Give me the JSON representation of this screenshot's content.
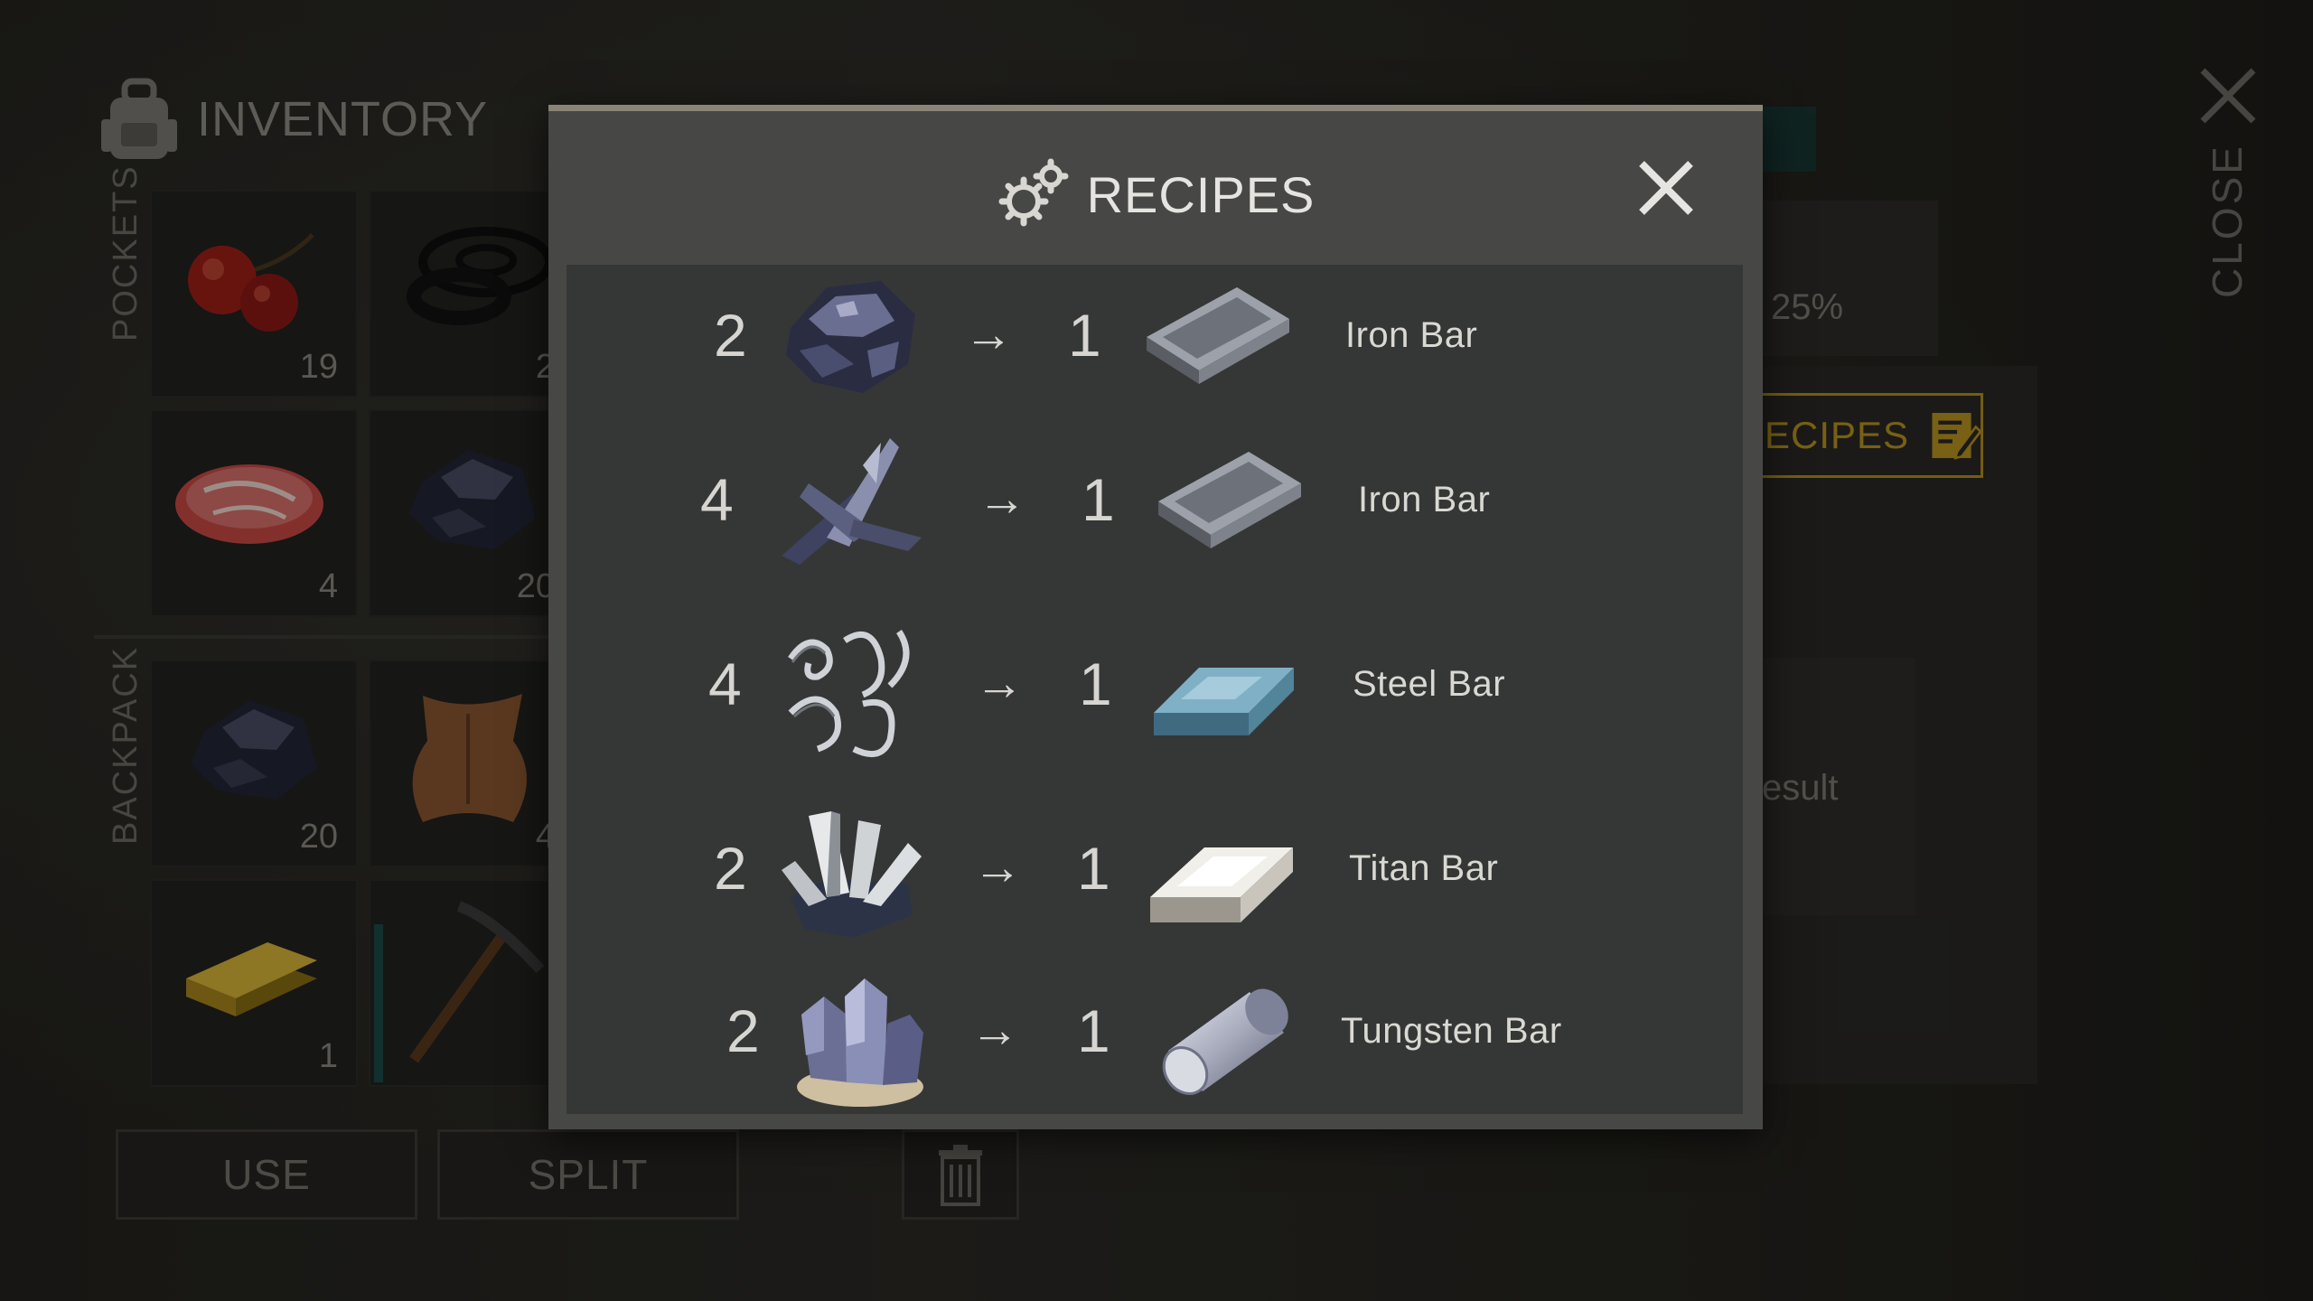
{
  "inventory": {
    "title": "INVENTORY",
    "pockets_label": "POCKETS",
    "backpack_label": "BACKPACK",
    "slots": [
      {
        "icon": "berries-icon",
        "count": "19"
      },
      {
        "icon": "rings-icon",
        "count": "2"
      },
      {
        "icon": "meat-icon",
        "count": "4"
      },
      {
        "icon": "ore-icon",
        "count": "20"
      },
      {
        "icon": "ore-icon",
        "count": "20"
      },
      {
        "icon": "hide-icon",
        "count": "4"
      },
      {
        "icon": "gold-bar-icon",
        "count": "1"
      },
      {
        "icon": "pickaxe-icon",
        "count": ""
      }
    ],
    "use_label": "USE",
    "split_label": "SPLIT"
  },
  "background_right": {
    "percent_text": "25%",
    "recipes_button_label": "ECIPES",
    "result_text": "esult",
    "close_label": "CLOSE"
  },
  "modal": {
    "title": "RECIPES",
    "recipes": [
      {
        "input_qty": "2",
        "input_icon": "iron-ore-icon",
        "arrow": "→",
        "output_qty": "1",
        "output_icon": "iron-bar-icon",
        "output_name": "Iron Bar"
      },
      {
        "input_qty": "4",
        "input_icon": "scrap-metal-icon",
        "arrow": "→",
        "output_qty": "1",
        "output_icon": "iron-bar-icon",
        "output_name": "Iron Bar"
      },
      {
        "input_qty": "4",
        "input_icon": "metal-shavings-icon",
        "arrow": "→",
        "output_qty": "1",
        "output_icon": "steel-bar-icon",
        "output_name": "Steel Bar"
      },
      {
        "input_qty": "2",
        "input_icon": "titan-ore-icon",
        "arrow": "→",
        "output_qty": "1",
        "output_icon": "titan-bar-icon",
        "output_name": "Titan Bar"
      },
      {
        "input_qty": "2",
        "input_icon": "tungsten-ore-icon",
        "arrow": "→",
        "output_qty": "1",
        "output_icon": "tungsten-bar-icon",
        "output_name": "Tungsten Bar"
      }
    ]
  },
  "colors": {
    "accent_gold": "#b8941f",
    "modal_bg": "#474845",
    "modal_body": "#353736"
  }
}
